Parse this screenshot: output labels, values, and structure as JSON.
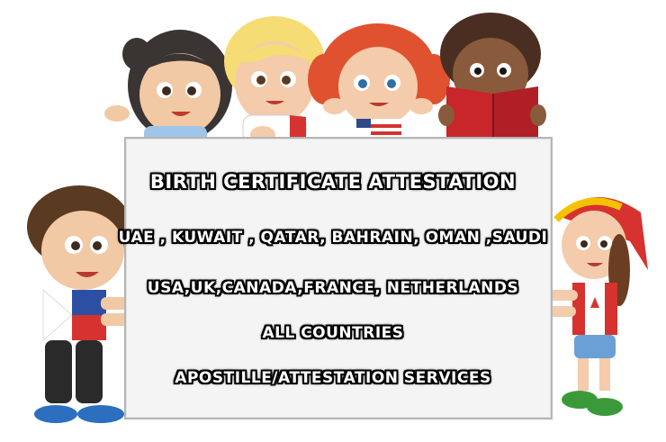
{
  "board": {
    "lines": [
      "BIRTH CERTIFICATE ATTESTATION",
      "UAE , KUWAIT , QATAR, BAHRAIN, OMAN ,SAUDI",
      "USA,UK,CANADA,FRANCE, NETHERLANDS",
      "ALL COUNTRIES",
      "APOSTILLE/ATTESTATION SERVICES"
    ]
  },
  "illustration": {
    "characters": [
      "girl-dark-hair",
      "boy-blonde",
      "girl-red-hair",
      "boy-curly-with-book",
      "boy-left-philippines",
      "girl-right-canada-cap"
    ],
    "colors": {
      "board": "#f4f4f4",
      "text": "#ffffff",
      "text_outline": "#000000",
      "book": "#c8262b",
      "skin": "#f2c9a5",
      "skin_dark": "#8a5a3c"
    }
  }
}
